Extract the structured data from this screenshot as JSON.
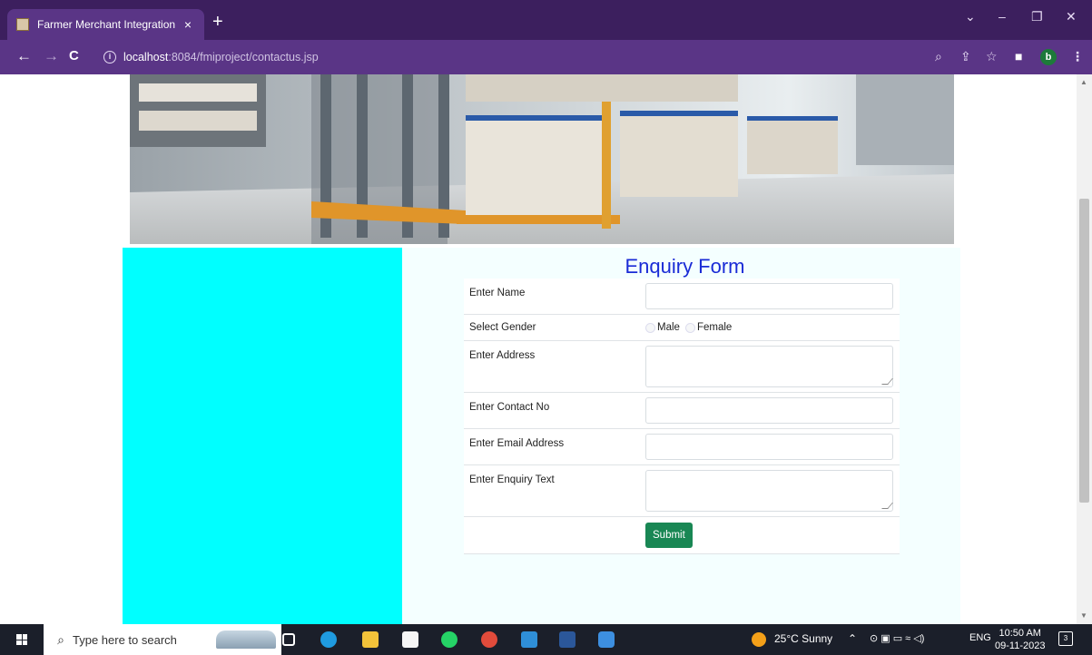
{
  "browser": {
    "tab_title": "Farmer Merchant Integration",
    "tab_close": "×",
    "new_tab": "+",
    "url_host": "localhost",
    "url_path": ":8084/fmiproject/contactus.jsp",
    "profile_initial": "b",
    "window_controls": {
      "minimize": "–",
      "restore": "❐",
      "close": "✕",
      "dropdown": "⌄"
    }
  },
  "page": {
    "form_title": "Enquiry Form",
    "fields": [
      {
        "label": "Enter Name",
        "type": "input",
        "value": ""
      },
      {
        "label": "Select Gender",
        "type": "radio",
        "options": [
          "Male",
          "Female"
        ]
      },
      {
        "label": "Enter Address",
        "type": "textarea",
        "value": ""
      },
      {
        "label": "Enter Contact No",
        "type": "input",
        "value": ""
      },
      {
        "label": "Enter Email Address",
        "type": "input",
        "value": ""
      },
      {
        "label": "Enter Enquiry Text",
        "type": "textarea",
        "value": ""
      }
    ],
    "submit_label": "Submit",
    "colors": {
      "left_panel": "#00ffff",
      "title": "#1a2bd6",
      "submit": "#198754",
      "form_bg": "#f4ffff"
    }
  },
  "taskbar": {
    "search_placeholder": "Type here to search",
    "weather": "25°C  Sunny",
    "language": "ENG",
    "time": "10:50 AM",
    "date": "09-11-2023",
    "notification_count": "3"
  }
}
